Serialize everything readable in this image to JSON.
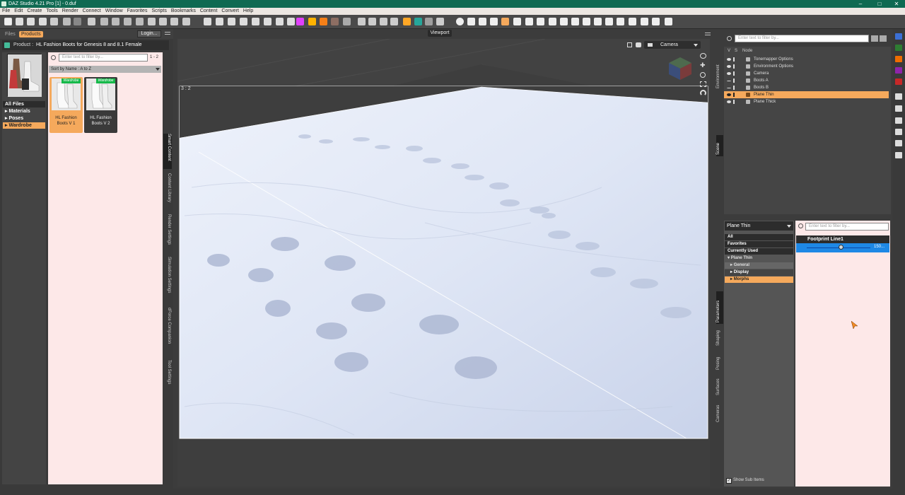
{
  "window": {
    "title": "DAZ Studio 4.21 Pro [1] - 0.duf"
  },
  "menu": [
    "File",
    "Edit",
    "Create",
    "Tools",
    "Render",
    "Connect",
    "Window",
    "Favorites",
    "Scripts",
    "Bookmarks",
    "Content",
    "Convert",
    "Help"
  ],
  "left_pane": {
    "tabs": {
      "files": "Files",
      "products": "Products"
    },
    "login": "Login...",
    "product_prefix": "Product :",
    "product_name": "HL Fashion Boots for Genesis 8 and 8.1 Female",
    "categories": {
      "all": "All Files",
      "materials": "Materials",
      "poses": "Poses",
      "wardrobe": "Wardrobe"
    },
    "filter_placeholder": "Enter text to filter by...",
    "page_count": "1 - 2",
    "sort": "Sort by Name : A to Z",
    "items": [
      {
        "badge": "Wardrobe",
        "label": "HL Fashion Boots V 1",
        "selected": true
      },
      {
        "badge": "Wardrobe",
        "label": "HL Fashion Boots V 2",
        "selected": false
      }
    ],
    "vertical_tabs": [
      "Smart Content",
      "Content Library",
      "Render Settings",
      "Simulation Settings",
      "dForce Companion",
      "Tool Settings"
    ]
  },
  "viewport": {
    "title": "Viewport",
    "camera": "Camera",
    "aspect": "3 : 2"
  },
  "scene": {
    "filter_placeholder": "Enter text to filter by...",
    "columns": {
      "v": "V",
      "s": "S",
      "node": "Node"
    },
    "nodes": [
      {
        "name": "Tonemapper Options",
        "selected": false
      },
      {
        "name": "Environment Options",
        "selected": false
      },
      {
        "name": "Camera",
        "selected": false
      },
      {
        "name": "Boots A",
        "selected": false
      },
      {
        "name": "Boots B",
        "selected": false
      },
      {
        "name": "Plane Thin",
        "selected": true
      },
      {
        "name": "Plane Thick",
        "selected": false
      }
    ],
    "side_tabs": {
      "environment": "Environment",
      "scene": "Scene"
    }
  },
  "parameters": {
    "node_select": "Plane Thin",
    "filter_placeholder": "Enter text to filter by...",
    "tree": {
      "all": "All",
      "favorites": "Favorites",
      "currently_used": "Currently Used",
      "root": "Plane Thin",
      "general": "General",
      "display": "Display",
      "morphs": "Morphs"
    },
    "slider": {
      "label": "Footprint Line1",
      "value": "150..."
    },
    "show_sub_items": "Show Sub Items",
    "side_tabs": [
      "Parameters",
      "Shaping",
      "Posing",
      "Surfaces",
      "Cameras"
    ]
  },
  "colors": {
    "title_bar": "#0f6a52",
    "accent_orange": "#f5a95c",
    "selection_blue": "#1e88e5",
    "pink_bg": "#fde8e8"
  }
}
